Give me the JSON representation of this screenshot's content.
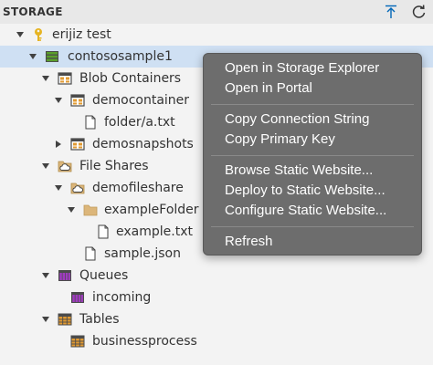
{
  "header": {
    "title": "STORAGE",
    "icons": [
      "chevron-down-icon",
      "upload-icon",
      "refresh-icon"
    ]
  },
  "tree": {
    "account": "erijiz test",
    "storage_account": "contososample1",
    "blob_containers": "Blob Containers",
    "democontainer": "democontainer",
    "folder_file": "folder/a.txt",
    "demosnapshots": "demosnapshots",
    "file_shares": "File Shares",
    "demofileshare": "demofileshare",
    "example_folder": "exampleFolder",
    "example_txt": "example.txt",
    "sample_json": "sample.json",
    "queues": "Queues",
    "incoming": "incoming",
    "tables": "Tables",
    "businessprocess": "businessprocess"
  },
  "context_menu": {
    "items": [
      "Open in Storage Explorer",
      "Open in Portal",
      "Copy Connection String",
      "Copy Primary Key",
      "Browse Static Website...",
      "Deploy to Static Website...",
      "Configure Static Website...",
      "Refresh"
    ]
  },
  "colors": {
    "selected_row": "#cfe0f3",
    "menu_bg": "#6d6d6d",
    "accent_blue": "#0066b8",
    "key_yellow": "#e6b422",
    "storage_green": "#5aa02c",
    "queue_purple": "#7b2d8e",
    "table_orange": "#e19a32"
  }
}
